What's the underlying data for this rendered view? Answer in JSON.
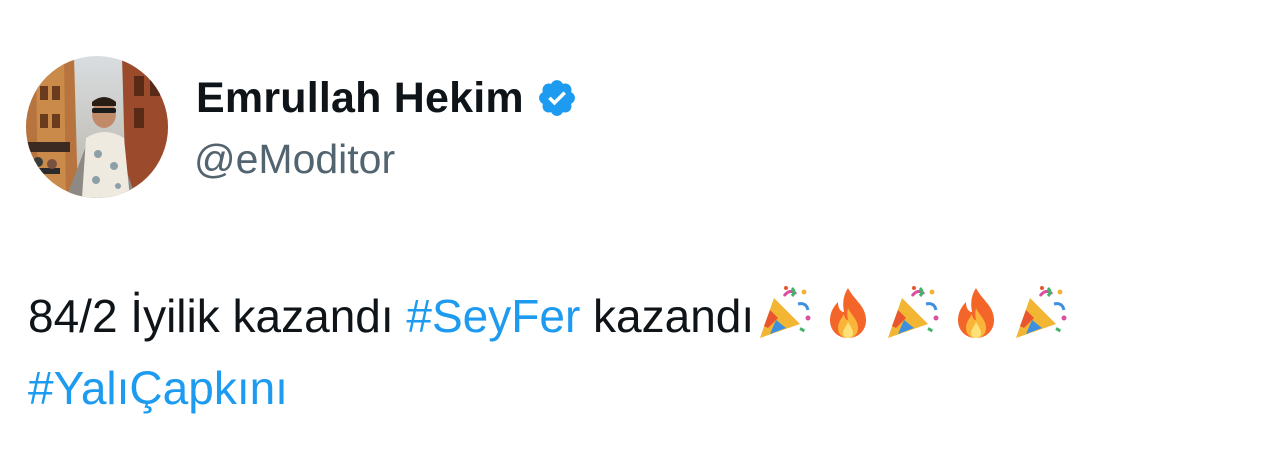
{
  "tweet": {
    "author": {
      "display_name": "Emrullah Hekim",
      "handle": "@eModitor",
      "verified": true,
      "verified_icon": "verified-badge-icon",
      "badge_color": "#1d9bf0"
    },
    "text_parts": {
      "line1_text_a": "84/2 İyilik kazandı ",
      "hashtag_1": "#SeyFer",
      "line1_text_b": " kazandı",
      "hashtag_2": "#YalıÇapkını"
    },
    "emojis": [
      "party-popper-icon",
      "fire-icon",
      "party-popper-icon",
      "fire-icon",
      "party-popper-icon"
    ],
    "colors": {
      "text": "#0f1419",
      "secondary": "#536471",
      "link": "#1d9bf0"
    }
  }
}
